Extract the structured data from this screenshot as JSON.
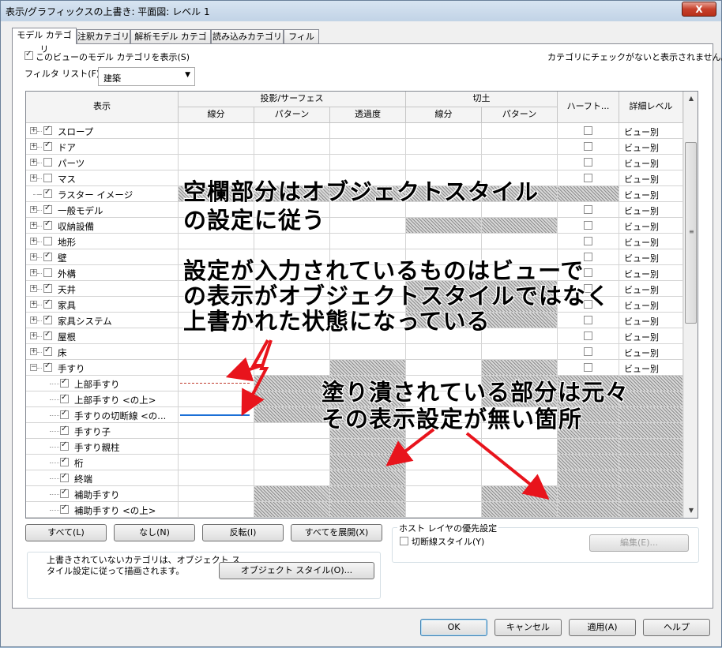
{
  "window": {
    "title": "表示/グラフィックスの上書き: 平面図: レベル 1",
    "close": "X"
  },
  "tabs": [
    {
      "label": "モデル カテゴリ"
    },
    {
      "label": "注釈カテゴリ"
    },
    {
      "label": "解析モデル カテゴリ"
    },
    {
      "label": "読み込みカテゴリ"
    },
    {
      "label": "フィルタ"
    }
  ],
  "show_model_categories": {
    "label": "このビューのモデル カテゴリを表示(S)",
    "checked": true
  },
  "hidden_note": "カテゴリにチェックがないと表示されません。",
  "filter": {
    "label": "フィルタ リスト(F):",
    "value": "建築"
  },
  "headers": {
    "visibility": "表示",
    "projection": "投影/サーフェス",
    "cut": "切土",
    "line": "線分",
    "pattern": "パターン",
    "transparency": "透過度",
    "cut_line": "線分",
    "cut_pattern": "パターン",
    "halftone": "ハーフト...",
    "detail": "詳細レベル"
  },
  "rows": [
    {
      "name": "スロープ",
      "exp": true,
      "checked": true,
      "ht": true,
      "detail": "ビュー別",
      "lvl": 0
    },
    {
      "name": "ドア",
      "exp": true,
      "checked": true,
      "ht": true,
      "detail": "ビュー別",
      "lvl": 0
    },
    {
      "name": "パーツ",
      "exp": true,
      "checked": false,
      "ht": true,
      "detail": "ビュー別",
      "lvl": 0
    },
    {
      "name": "マス",
      "exp": true,
      "checked": false,
      "ht": true,
      "detail": "ビュー別",
      "lvl": 0
    },
    {
      "name": "ラスター イメージ",
      "exp": false,
      "checked": true,
      "ht": false,
      "detail": "ビュー別",
      "lvl": 0,
      "hatch": [
        1,
        2,
        3,
        4,
        5,
        6
      ]
    },
    {
      "name": "一般モデル",
      "exp": true,
      "checked": true,
      "ht": true,
      "detail": "ビュー別",
      "lvl": 0
    },
    {
      "name": "収納設備",
      "exp": true,
      "checked": true,
      "ht": true,
      "detail": "ビュー別",
      "lvl": 0,
      "hatch": [
        4,
        5
      ]
    },
    {
      "name": "地形",
      "exp": true,
      "checked": false,
      "ht": true,
      "detail": "ビュー別",
      "lvl": 0
    },
    {
      "name": "壁",
      "exp": true,
      "checked": true,
      "ht": true,
      "detail": "ビュー別",
      "lvl": 0
    },
    {
      "name": "外構",
      "exp": true,
      "checked": false,
      "ht": true,
      "detail": "ビュー別",
      "lvl": 0
    },
    {
      "name": "天井",
      "exp": true,
      "checked": true,
      "ht": true,
      "detail": "ビュー別",
      "lvl": 0,
      "hatch": [
        4,
        5
      ]
    },
    {
      "name": "家具",
      "exp": true,
      "checked": true,
      "ht": true,
      "detail": "ビュー別",
      "lvl": 0,
      "hatch": [
        4,
        5
      ]
    },
    {
      "name": "家具システム",
      "exp": true,
      "checked": true,
      "ht": true,
      "detail": "ビュー別",
      "lvl": 0,
      "hatch": [
        4,
        5
      ]
    },
    {
      "name": "屋根",
      "exp": true,
      "checked": true,
      "ht": true,
      "detail": "ビュー別",
      "lvl": 0
    },
    {
      "name": "床",
      "exp": true,
      "checked": true,
      "ht": true,
      "detail": "ビュー別",
      "lvl": 0
    },
    {
      "name": "手すり",
      "exp": true,
      "expanded": true,
      "checked": true,
      "ht": true,
      "detail": "ビュー別",
      "lvl": 0,
      "hatch": [
        3,
        5
      ]
    },
    {
      "name": "上部手すり",
      "checked": true,
      "ht": false,
      "detail": "",
      "lvl": 1,
      "hatch": [
        2,
        3,
        5,
        6,
        7
      ],
      "redline": true
    },
    {
      "name": "上部手すり <の上>",
      "checked": true,
      "ht": false,
      "detail": "",
      "lvl": 1,
      "hatch": [
        2,
        3,
        5,
        6,
        7
      ]
    },
    {
      "name": "手すりの切断線 <の...",
      "checked": true,
      "ht": false,
      "detail": "",
      "lvl": 1,
      "hatch": [
        2,
        3,
        6,
        7
      ],
      "blueline": true
    },
    {
      "name": "手すり子",
      "checked": true,
      "ht": false,
      "detail": "",
      "lvl": 1,
      "hatch": [
        3,
        6,
        7
      ]
    },
    {
      "name": "手すり親柱",
      "checked": true,
      "ht": false,
      "detail": "",
      "lvl": 1,
      "hatch": [
        3,
        6,
        7
      ]
    },
    {
      "name": "桁",
      "checked": true,
      "ht": false,
      "detail": "",
      "lvl": 1,
      "hatch": [
        3,
        6,
        7
      ]
    },
    {
      "name": "終端",
      "checked": true,
      "ht": false,
      "detail": "",
      "lvl": 1,
      "hatch": [
        3,
        6,
        7
      ]
    },
    {
      "name": "補助手すり",
      "checked": true,
      "ht": false,
      "detail": "",
      "lvl": 1,
      "hatch": [
        2,
        3,
        5,
        6,
        7
      ]
    },
    {
      "name": "補助手すり <の上>",
      "checked": true,
      "ht": false,
      "detail": "",
      "lvl": 1,
      "hatch": [
        2,
        3,
        5,
        6,
        7
      ]
    }
  ],
  "buttons": {
    "all": "すべて(L)",
    "none": "なし(N)",
    "invert": "反転(I)",
    "expand_all": "すべてを展開(X)",
    "object_styles": "オブジェクト スタイル(O)...",
    "edit": "編集(E)...",
    "ok": "OK",
    "cancel": "キャンセル",
    "apply": "適用(A)",
    "help": "ヘルプ"
  },
  "host_layer": {
    "title": "ホスト レイヤの優先設定",
    "cut_line_styles": "切断線スタイル(Y)",
    "checked": false
  },
  "note": {
    "line1": "上書きされていないカテゴリは、オブジェクト ス",
    "line2": "タイル設定に従って描画されます。"
  },
  "annotations": {
    "a1_l1": "空欄部分はオブジェクトスタイル",
    "a1_l2": "の設定に従う",
    "a2_l1": "設定が入力されているものはビューで",
    "a2_l2": "の表示がオブジェクトスタイルではなく",
    "a2_l3": "上書かれた状態になっている",
    "a3_l1": "塗り潰されている部分は元々",
    "a3_l2": "その表示設定が無い箇所"
  }
}
